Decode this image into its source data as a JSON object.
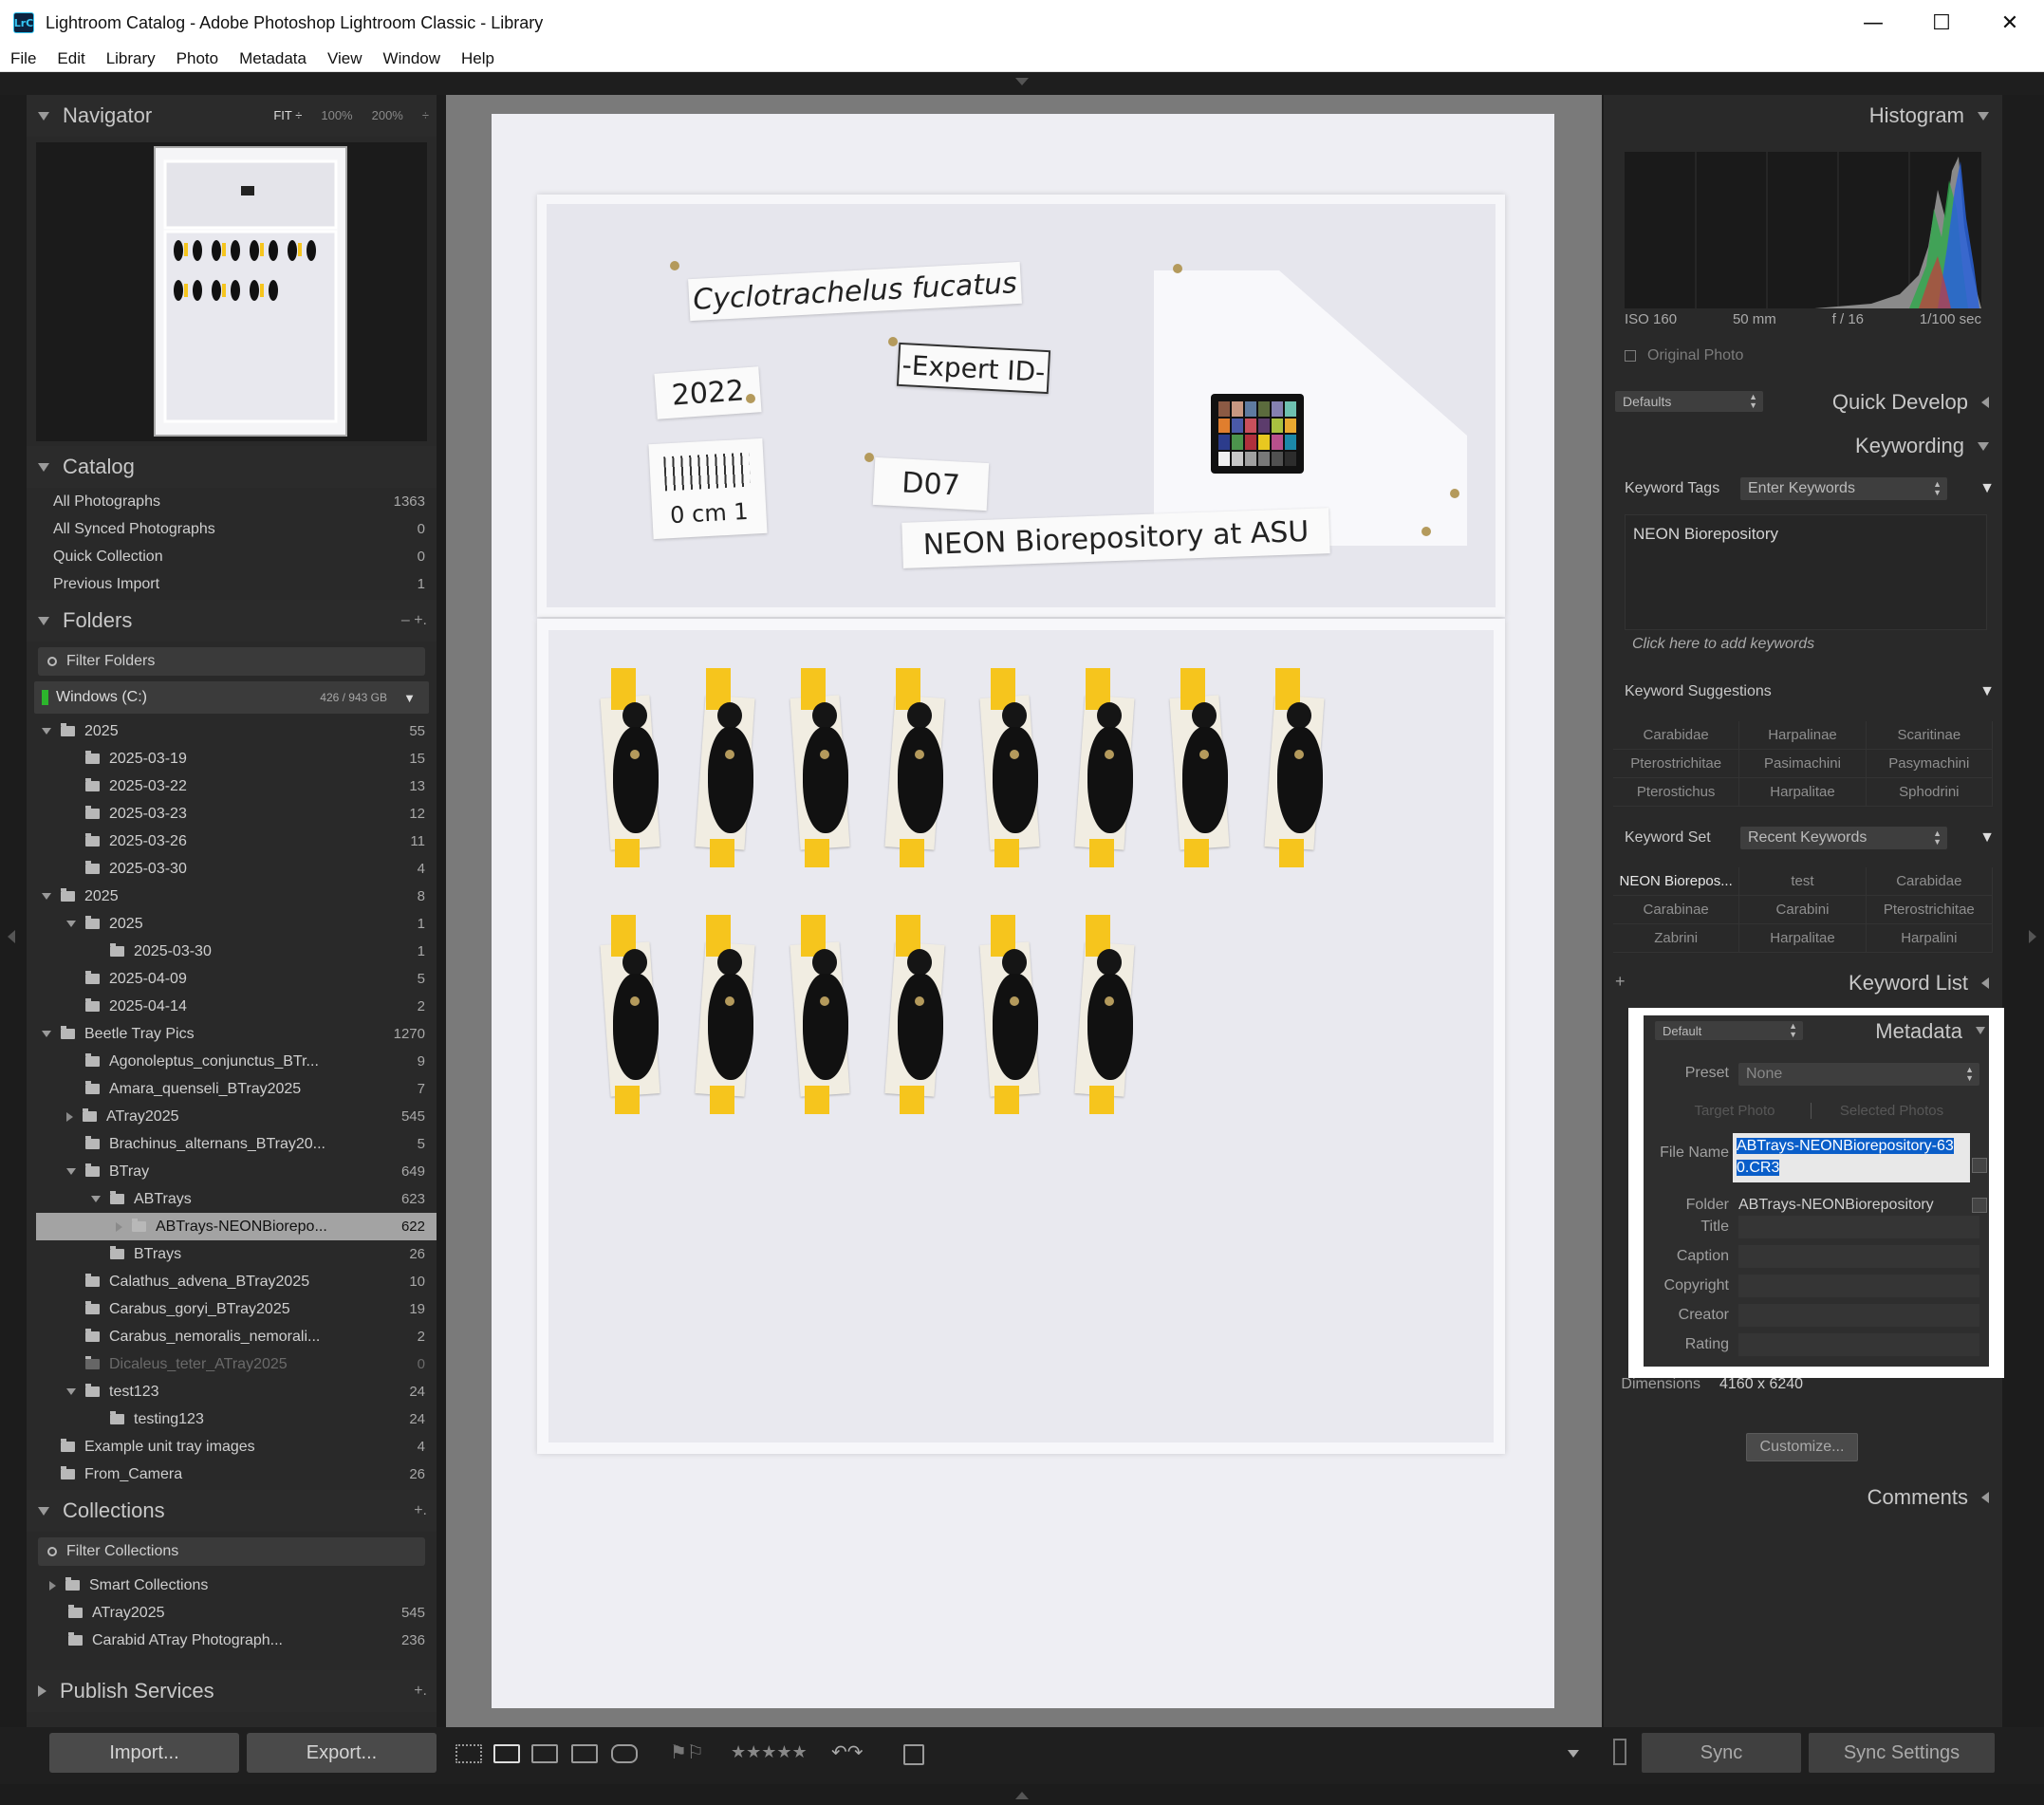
{
  "window": {
    "title": "Lightroom Catalog - Adobe Photoshop Lightroom Classic - Library",
    "app_icon_text": "LrC",
    "minimize": "—",
    "maximize": "☐",
    "close": "✕"
  },
  "menu": [
    "File",
    "Edit",
    "Library",
    "Photo",
    "Metadata",
    "View",
    "Window",
    "Help"
  ],
  "navigator": {
    "title": "Navigator",
    "zoom_fit": "FIT ÷",
    "zoom_100": "100%",
    "zoom_200": "200%",
    "zoom_more": "÷"
  },
  "catalog": {
    "title": "Catalog",
    "items": [
      {
        "label": "All Photographs",
        "count": "1363"
      },
      {
        "label": "All Synced Photographs",
        "count": "0"
      },
      {
        "label": "Quick Collection",
        "count": "0"
      },
      {
        "label": "Previous Import",
        "count": "1"
      }
    ]
  },
  "folders": {
    "title": "Folders",
    "actions": "–  +.",
    "filter_placeholder": "Filter Folders",
    "volume": {
      "name": "Windows (C:)",
      "size": "426 / 943 GB"
    },
    "items": [
      {
        "label": "2025",
        "count": "55",
        "level": 0,
        "disc": "down",
        "dim": false,
        "selected": false
      },
      {
        "label": "2025-03-19",
        "count": "15",
        "level": 1,
        "disc": "none",
        "dim": false,
        "selected": false
      },
      {
        "label": "2025-03-22",
        "count": "13",
        "level": 1,
        "disc": "none",
        "dim": false,
        "selected": false
      },
      {
        "label": "2025-03-23",
        "count": "12",
        "level": 1,
        "disc": "none",
        "dim": false,
        "selected": false
      },
      {
        "label": "2025-03-26",
        "count": "11",
        "level": 1,
        "disc": "none",
        "dim": false,
        "selected": false
      },
      {
        "label": "2025-03-30",
        "count": "4",
        "level": 1,
        "disc": "none",
        "dim": false,
        "selected": false
      },
      {
        "label": "2025",
        "count": "8",
        "level": 0,
        "disc": "down",
        "dim": false,
        "selected": false
      },
      {
        "label": "2025",
        "count": "1",
        "level": 1,
        "disc": "down",
        "dim": false,
        "selected": false
      },
      {
        "label": "2025-03-30",
        "count": "1",
        "level": 2,
        "disc": "none",
        "dim": false,
        "selected": false
      },
      {
        "label": "2025-04-09",
        "count": "5",
        "level": 1,
        "disc": "none",
        "dim": false,
        "selected": false
      },
      {
        "label": "2025-04-14",
        "count": "2",
        "level": 1,
        "disc": "none",
        "dim": false,
        "selected": false
      },
      {
        "label": "Beetle Tray Pics",
        "count": "1270",
        "level": 0,
        "disc": "down",
        "dim": false,
        "selected": false
      },
      {
        "label": "Agonoleptus_conjunctus_BTr...",
        "count": "9",
        "level": 1,
        "disc": "none",
        "dim": false,
        "selected": false
      },
      {
        "label": "Amara_quenseli_BTray2025",
        "count": "7",
        "level": 1,
        "disc": "none",
        "dim": false,
        "selected": false
      },
      {
        "label": "ATray2025",
        "count": "545",
        "level": 1,
        "disc": "right",
        "dim": false,
        "selected": false
      },
      {
        "label": "Brachinus_alternans_BTray20...",
        "count": "5",
        "level": 1,
        "disc": "none",
        "dim": false,
        "selected": false
      },
      {
        "label": "BTray",
        "count": "649",
        "level": 1,
        "disc": "down",
        "dim": false,
        "selected": false
      },
      {
        "label": "ABTrays",
        "count": "623",
        "level": 2,
        "disc": "down",
        "dim": false,
        "selected": false
      },
      {
        "label": "ABTrays-NEONBiorepo...",
        "count": "622",
        "level": 3,
        "disc": "right",
        "dim": false,
        "selected": true
      },
      {
        "label": "BTrays",
        "count": "26",
        "level": 2,
        "disc": "none",
        "dim": false,
        "selected": false
      },
      {
        "label": "Calathus_advena_BTray2025",
        "count": "10",
        "level": 1,
        "disc": "none",
        "dim": false,
        "selected": false
      },
      {
        "label": "Carabus_goryi_BTray2025",
        "count": "19",
        "level": 1,
        "disc": "none",
        "dim": false,
        "selected": false
      },
      {
        "label": "Carabus_nemoralis_nemorali...",
        "count": "2",
        "level": 1,
        "disc": "none",
        "dim": false,
        "selected": false
      },
      {
        "label": "Dicaleus_teter_ATray2025",
        "count": "0",
        "level": 1,
        "disc": "none",
        "dim": true,
        "selected": false
      },
      {
        "label": "test123",
        "count": "24",
        "level": 1,
        "disc": "down",
        "dim": false,
        "selected": false
      },
      {
        "label": "testing123",
        "count": "24",
        "level": 2,
        "disc": "none",
        "dim": false,
        "selected": false
      },
      {
        "label": "Example unit tray images",
        "count": "4",
        "level": 0,
        "disc": "none",
        "dim": false,
        "selected": false
      },
      {
        "label": "From_Camera",
        "count": "26",
        "level": 0,
        "disc": "none",
        "dim": false,
        "selected": false
      }
    ]
  },
  "collections": {
    "title": "Collections",
    "action": "+.",
    "filter_placeholder": "Filter Collections",
    "items": [
      {
        "label": "Smart Collections",
        "count": ""
      },
      {
        "label": "ATray2025",
        "count": "545"
      },
      {
        "label": "Carabid ATray Photograph...",
        "count": "236"
      }
    ]
  },
  "publish": {
    "title": "Publish Services",
    "action": "+."
  },
  "left_buttons": {
    "import": "Import...",
    "export": "Export..."
  },
  "photo": {
    "species_label": "Cyclotrachelus fucatus",
    "year_label": "2022",
    "expert_label": "-Expert ID-",
    "plot_label": "D07",
    "scale_label": "0 cm   1",
    "repo_label": "NEON Biorepository at ASU"
  },
  "histogram": {
    "title": "Histogram",
    "iso": "ISO 160",
    "focal": "50 mm",
    "aperture": "f / 16",
    "shutter": "1/100 sec",
    "original_photo": "Original Photo"
  },
  "quick_develop": {
    "title": "Quick Develop",
    "preset": "Defaults"
  },
  "keywording": {
    "title": "Keywording",
    "tags_label": "Keyword Tags",
    "tags_select": "Enter Keywords",
    "keywords_text": "NEON Biorepository",
    "add_hint": "Click here to add keywords",
    "suggestions_label": "Keyword Suggestions",
    "suggestions": [
      "Carabidae",
      "Harpalinae",
      "Scaritinae",
      "Pterostrichitae",
      "Pasimachini",
      "Pasymachini",
      "Pterostichus",
      "Harpalitae",
      "Sphodrini"
    ],
    "set_label": "Keyword Set",
    "set_select": "Recent Keywords",
    "set_items": [
      "NEON Biorepos...",
      "test",
      "Carabidae",
      "Carabinae",
      "Carabini",
      "Pterostrichitae",
      "Zabrini",
      "Harpalitae",
      "Harpalini"
    ]
  },
  "keyword_list": {
    "title": "Keyword List",
    "add": "+"
  },
  "metadata": {
    "title": "Metadata",
    "preset_select": "Default",
    "preset_label": "Preset",
    "preset_value": "None",
    "target_photo": "Target Photo",
    "selected_photos": "Selected Photos",
    "file_name_label": "File Name",
    "file_name_value": "ABTrays-NEONBiorepository-630.CR3",
    "folder_label": "Folder",
    "folder_value": "ABTrays-NEONBiorepository",
    "title_label": "Title",
    "caption_label": "Caption",
    "copyright_label": "Copyright",
    "creator_label": "Creator",
    "rating_label": "Rating",
    "dimensions_label": "Dimensions",
    "dimensions_value": "4160 x 6240",
    "customize": "Customize..."
  },
  "comments": {
    "title": "Comments"
  },
  "right_buttons": {
    "sync": "Sync",
    "sync_settings": "Sync Settings"
  },
  "toolbar": {
    "stars": "★★★★★"
  },
  "colors": {
    "panel": "#292929",
    "center_bg": "#7a7a7a",
    "selection": "#0a5ec9",
    "folder_selected": "#a3a3a3"
  }
}
